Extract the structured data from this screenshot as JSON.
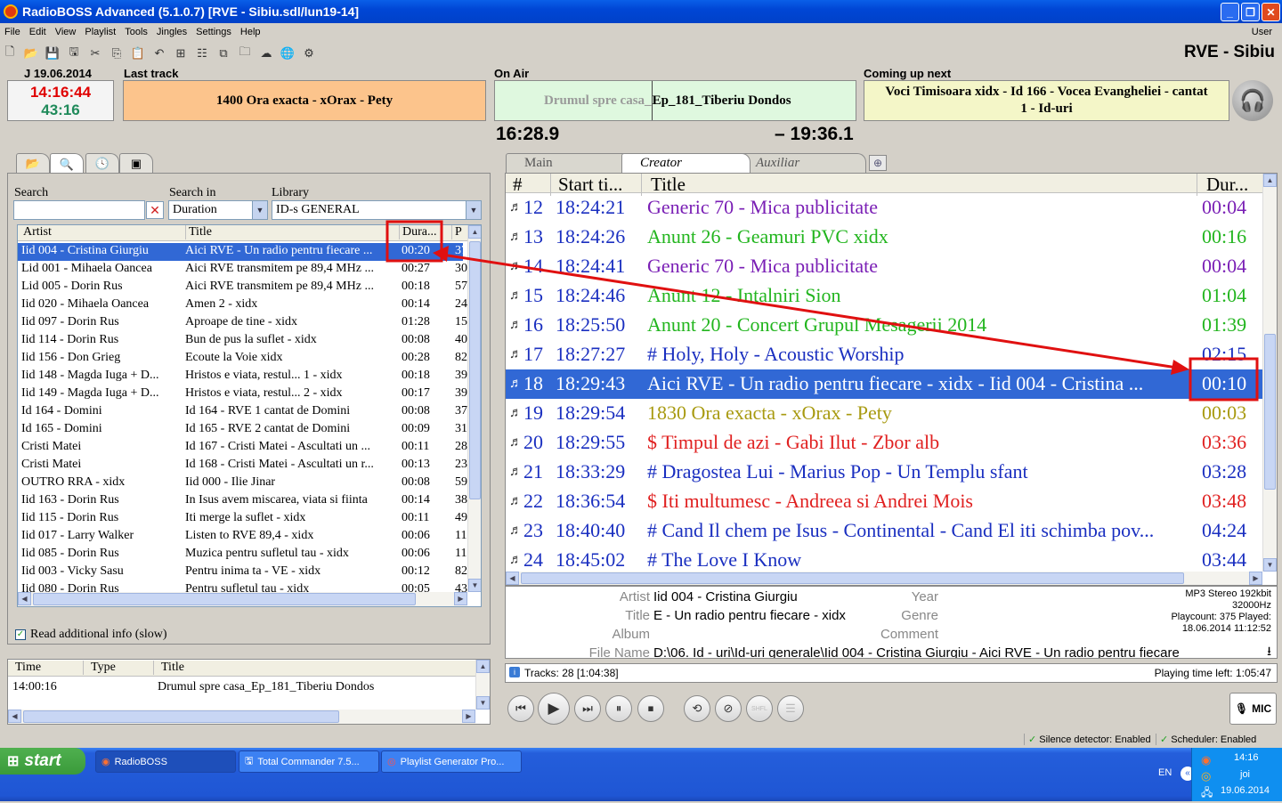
{
  "window": {
    "title": "RadioBOSS Advanced (5.1.0.7)  [RVE - Sibiu.sdl/lun19-14]",
    "minimize": "_",
    "maximize": "❐",
    "close": "✕"
  },
  "menu": [
    "File",
    "Edit",
    "View",
    "Playlist",
    "Tools",
    "Jingles",
    "Settings",
    "Help"
  ],
  "menu_user": "User",
  "station": "RVE - Sibiu",
  "header": {
    "date": "J 19.06.2014",
    "last_track_label": "Last track",
    "on_air_label": "On Air",
    "coming_up_label": "Coming up next",
    "clock": "14:16:44",
    "clock_sub": "43:16",
    "last_track": "1400 Ora exacta - xOrax - Pety",
    "on_air_played": "Drumul spre casa_",
    "on_air_rest": "Ep_181_Tiberiu Dondos",
    "coming_up": "Voci Timisoara xidx - Id 166 - Vocea Evangheliei - cantat 1 - Id-uri",
    "elapsed": "16:28.9",
    "remaining": "– 19:36.1"
  },
  "library": {
    "search_label": "Search",
    "search_in_label": "Search in",
    "search_in_value": "Duration",
    "library_label": "Library",
    "library_value": "ID-s GENERAL",
    "columns": [
      "Artist",
      "Title",
      "Dura...",
      "P"
    ],
    "rows": [
      [
        "Iid 004 - Cristina Giurgiu",
        "Aici RVE - Un radio pentru fiecare ...",
        "00:20",
        "37"
      ],
      [
        "Lid 001 - Mihaela Oancea",
        "Aici RVE transmitem pe 89,4 MHz ...",
        "00:27",
        "30"
      ],
      [
        "Lid 005 - Dorin Rus",
        "Aici RVE transmitem pe 89,4 MHz ...",
        "00:18",
        "57"
      ],
      [
        "Iid 020 - Mihaela Oancea",
        "Amen 2 - xidx",
        "00:14",
        "24"
      ],
      [
        "Iid 097 - Dorin Rus",
        "Aproape de tine - xidx",
        "01:28",
        "15"
      ],
      [
        "Iid 114 - Dorin Rus",
        "Bun de pus la suflet - xidx",
        "00:08",
        "40"
      ],
      [
        "Iid 156 - Don Grieg",
        "Ecoute la Voie xidx",
        "00:28",
        "82"
      ],
      [
        "Iid 148 - Magda Iuga + D...",
        "Hristos e viata, restul... 1 - xidx",
        "00:18",
        "39"
      ],
      [
        "Iid 149 - Magda Iuga + D...",
        "Hristos e viata, restul... 2 - xidx",
        "00:17",
        "39"
      ],
      [
        "Id 164 - Domini",
        "Id 164 - RVE 1 cantat de Domini",
        "00:08",
        "37"
      ],
      [
        "Id 165 - Domini",
        "Id 165 - RVE 2 cantat de Domini",
        "00:09",
        "31"
      ],
      [
        "Cristi Matei",
        "Id 167 - Cristi Matei -  Ascultati un ...",
        "00:11",
        "28"
      ],
      [
        "Cristi Matei",
        "Id 168 - Cristi Matei - Ascultati un r...",
        "00:13",
        "23"
      ],
      [
        "OUTRO RRA - xidx",
        "Iid 000 - Ilie Jinar",
        "00:08",
        "59"
      ],
      [
        "Iid 163 - Dorin Rus",
        "In Isus avem miscarea, viata si fiinta",
        "00:14",
        "38"
      ],
      [
        "Iid 115 - Dorin Rus",
        "Iti merge la suflet - xidx",
        "00:11",
        "49"
      ],
      [
        "Iid 017 - Larry Walker",
        "Listen to RVE 89,4 - xidx",
        "00:06",
        "11"
      ],
      [
        "Iid 085 - Dorin Rus",
        "Muzica pentru sufletul tau - xidx",
        "00:06",
        "11"
      ],
      [
        "Iid 003 - Vicky Sasu",
        "Pentru inima ta - VE - xidx",
        "00:12",
        "82"
      ],
      [
        "Iid 080 - Dorin Rus",
        "Pentru sufletul tau - xidx",
        "00:05",
        "43"
      ]
    ],
    "read_info_label": "Read additional info (slow)"
  },
  "history": {
    "columns": [
      "Time",
      "Type",
      "Title"
    ],
    "rows": [
      [
        "14:00:16",
        "",
        "Drumul spre casa_Ep_181_Tiberiu Dondos"
      ]
    ]
  },
  "playlist": {
    "tabs": [
      "Main",
      "Creator",
      "Auxiliar"
    ],
    "tab_add": "⊕",
    "columns": [
      "#",
      "Start ti...",
      "Title",
      "Dur..."
    ],
    "rows": [
      {
        "n": "12",
        "start": "18:24:21",
        "title": "Generic 70 - Mica publicitate",
        "dur": "00:04",
        "color": "#7a1fb5"
      },
      {
        "n": "13",
        "start": "18:24:26",
        "title": "Anunt 26 - Geamuri PVC xidx",
        "dur": "00:16",
        "color": "#22b51e"
      },
      {
        "n": "14",
        "start": "18:24:41",
        "title": "Generic 70 - Mica publicitate",
        "dur": "00:04",
        "color": "#7a1fb5"
      },
      {
        "n": "15",
        "start": "18:24:46",
        "title": "Anunt 12 - Intalniri Sion",
        "dur": "01:04",
        "color": "#22b51e"
      },
      {
        "n": "16",
        "start": "18:25:50",
        "title": "Anunt 20 - Concert Grupul Mesagerii 2014",
        "dur": "01:39",
        "color": "#22b51e"
      },
      {
        "n": "17",
        "start": "18:27:27",
        "title": "# Holy, Holy - Acoustic Worship",
        "dur": "02:15",
        "color": "#1a2fc0"
      },
      {
        "n": "18",
        "start": "18:29:43",
        "title": "Aici RVE - Un radio pentru fiecare - xidx - Iid 004 - Cristina ...",
        "dur": "00:10",
        "color": "#ffffff"
      },
      {
        "n": "19",
        "start": "18:29:54",
        "title": "1830 Ora exacta - xOrax - Pety",
        "dur": "00:03",
        "color": "#a89a10"
      },
      {
        "n": "20",
        "start": "18:29:55",
        "title": "$ Timpul de azi - Gabi Ilut - Zbor alb",
        "dur": "03:36",
        "color": "#e02020"
      },
      {
        "n": "21",
        "start": "18:33:29",
        "title": "# Dragostea Lui - Marius Pop - Un Templu sfant",
        "dur": "03:28",
        "color": "#1a2fc0"
      },
      {
        "n": "22",
        "start": "18:36:54",
        "title": "$ Iti multumesc - Andreea si Andrei Mois",
        "dur": "03:48",
        "color": "#e02020"
      },
      {
        "n": "23",
        "start": "18:40:40",
        "title": "# Cand Il chem pe Isus - Continental - Cand El iti schimba pov...",
        "dur": "04:24",
        "color": "#1a2fc0"
      },
      {
        "n": "24",
        "start": "18:45:02",
        "title": "# The Love I Know",
        "dur": "03:44",
        "color": "#1a2fc0"
      }
    ],
    "selected_index": 6
  },
  "trackinfo": {
    "artist_label": "Artist",
    "artist": "Iid 004 - Cristina Giurgiu",
    "title_label": "Title",
    "title": "E - Un radio pentru fiecare - xidx",
    "album_label": "Album",
    "file_label": "File Name",
    "file": "D:\\06. Id - uri\\Id-uri generale\\Iid 004 - Cristina Giurgiu - Aici RVE - Un radio pentru fiecare",
    "year_label": "Year",
    "genre_label": "Genre",
    "comment_label": "Comment",
    "format": "MP3 Stereo 192kbit",
    "rate": "32000Hz",
    "playcount": "Playcount: 375  Played:",
    "played": "18.06.2014 11:12:52"
  },
  "playlist_status": {
    "tracks": "Tracks: 28 [1:04:38]",
    "time_left": "Playing time left: 1:05:47"
  },
  "controls": {
    "mic": "MIC",
    "shfl": "SHFL"
  },
  "statusbar": {
    "silence": "Silence detector: Enabled",
    "scheduler": "Scheduler: Enabled"
  },
  "taskbar": {
    "start": "start",
    "tasks": [
      "RadioBOSS",
      "Total Commander 7.5...",
      "Playlist Generator Pro..."
    ],
    "lang": "EN",
    "time": "14:16",
    "day": "joi",
    "date": "19.06.2014"
  },
  "colors": {
    "selection": "#3168d5",
    "annotation": "#e01010",
    "last_track_bg": "#fcc48c",
    "on_air_bg": "#dff8df",
    "next_bg": "#f4f6c8"
  }
}
